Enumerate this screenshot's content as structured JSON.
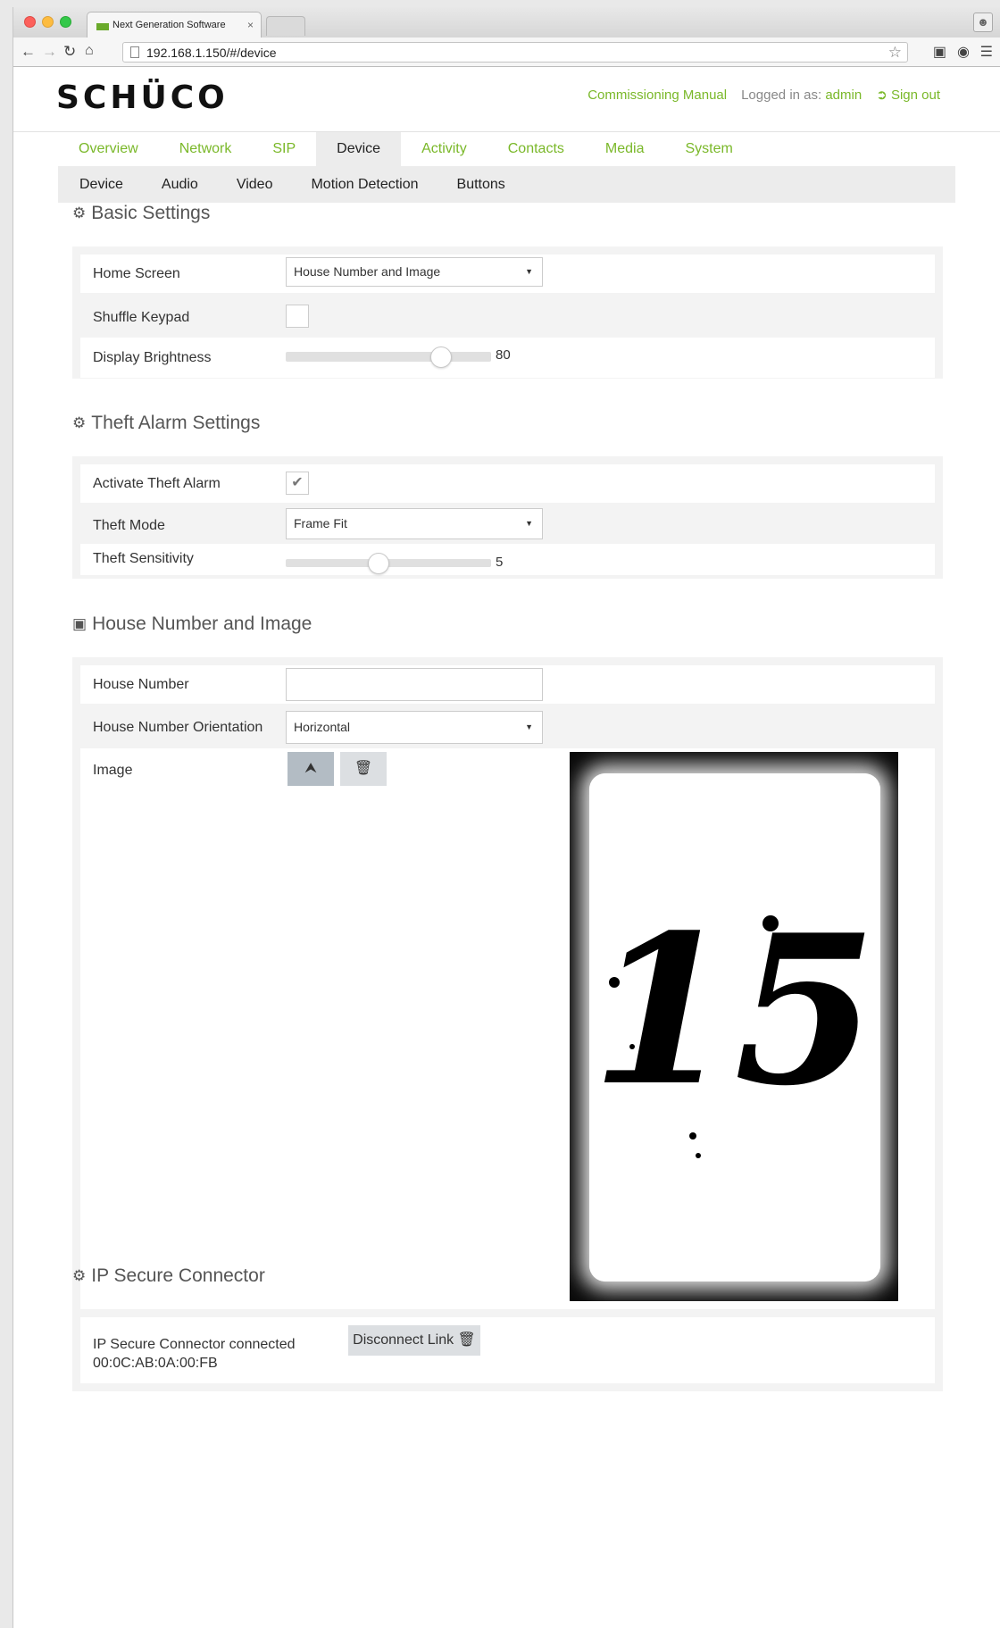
{
  "browser": {
    "tab_title": "Next Generation Software",
    "tab_close": "×",
    "url": "192.168.1.150/#/device"
  },
  "header": {
    "logo": "SCHÜCO",
    "commissioning_manual": "Commissioning Manual",
    "logged_in_label": "Logged in as:",
    "username": "admin",
    "sign_out": "Sign out"
  },
  "main_nav": [
    "Overview",
    "Network",
    "SIP",
    "Device",
    "Activity",
    "Contacts",
    "Media",
    "System"
  ],
  "main_nav_active": "Device",
  "sub_nav": [
    "Device",
    "Audio",
    "Video",
    "Motion Detection",
    "Buttons"
  ],
  "basic_settings": {
    "title": "Basic Settings",
    "home_screen_label": "Home Screen",
    "home_screen_value": "House Number and Image",
    "shuffle_keypad_label": "Shuffle Keypad",
    "shuffle_keypad_checked": false,
    "display_brightness_label": "Display Brightness",
    "display_brightness_value": "80",
    "display_brightness_fraction": 0.8
  },
  "theft_alarm": {
    "title": "Theft Alarm Settings",
    "activate_label": "Activate Theft Alarm",
    "activate_checked": true,
    "theft_mode_label": "Theft Mode",
    "theft_mode_value": "Frame Fit",
    "sensitivity_label": "Theft Sensitivity",
    "sensitivity_value": "5",
    "sensitivity_fraction": 0.45
  },
  "house_number": {
    "title": "House Number and Image",
    "house_number_label": "House Number",
    "house_number_value": "",
    "orientation_label": "House Number Orientation",
    "orientation_value": "Horizontal",
    "image_label": "Image",
    "image_text": "15"
  },
  "ip_secure": {
    "title": "IP Secure Connector",
    "status": "IP Secure Connector connected",
    "mac": "00:0C:AB:0A:00:FB",
    "disconnect_label": "Disconnect Link"
  },
  "colors": {
    "accent": "#7ab829",
    "panel_bg": "#f3f3f3",
    "nav_active_bg": "#ececec"
  },
  "icons": {
    "section": "gear-icon",
    "image_section": "picture-icon",
    "upload": "upload-icon",
    "delete": "trash-icon",
    "sign_out": "sign-out-icon"
  }
}
